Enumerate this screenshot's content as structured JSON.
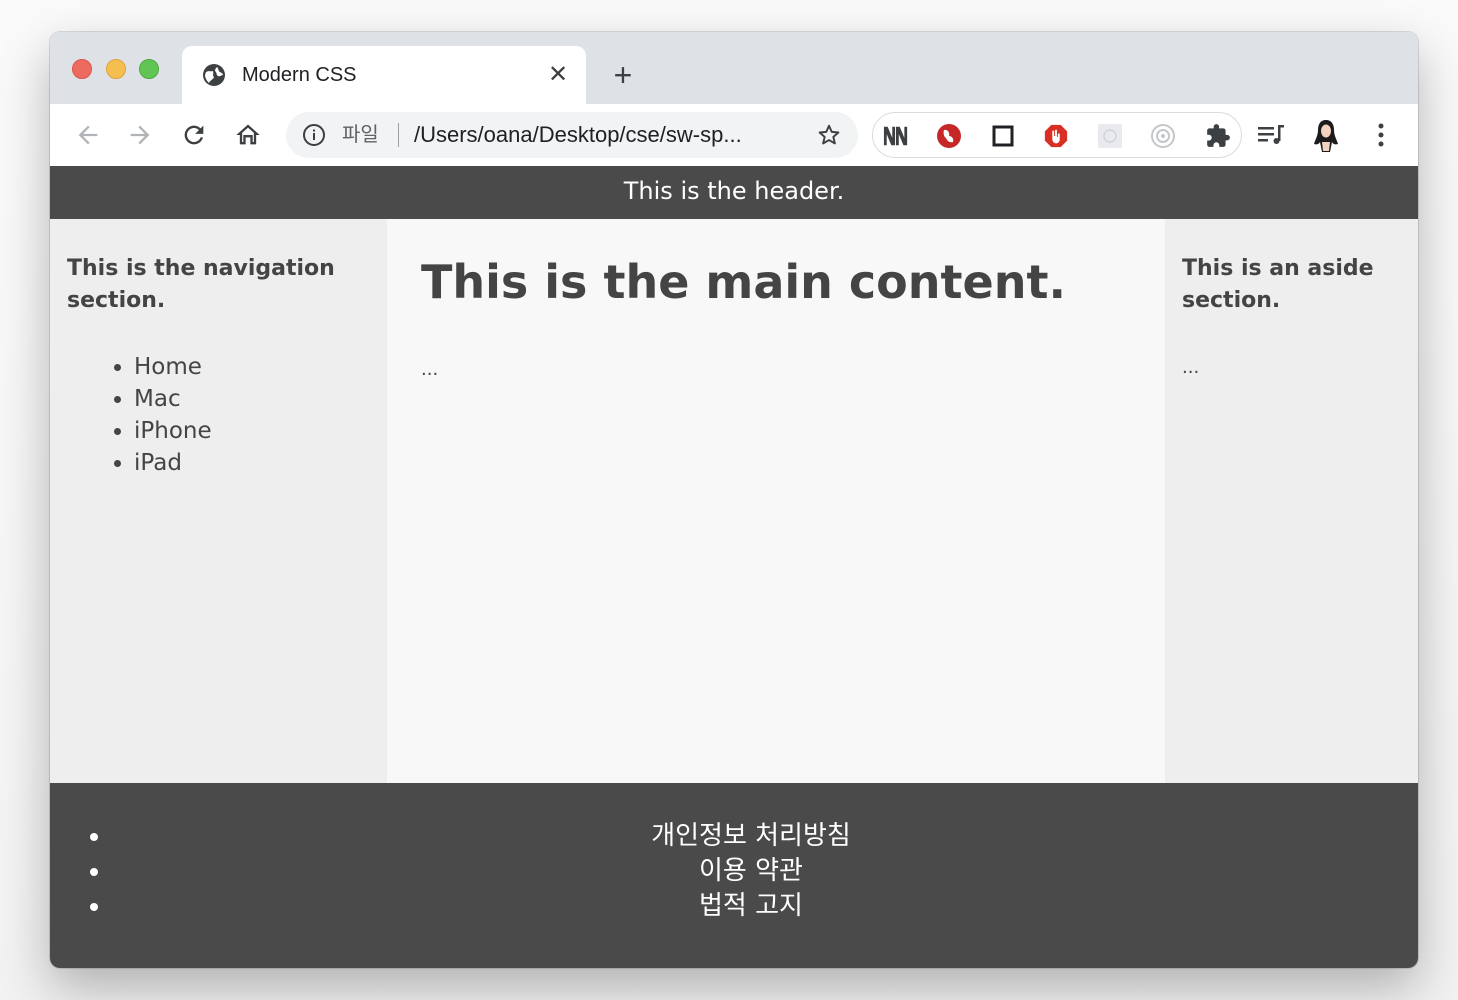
{
  "browser": {
    "tab": {
      "title": "Modern CSS",
      "favicon": "globe-icon"
    },
    "address_bar": {
      "scheme_label": "파일",
      "url": "/Users/oana/Desktop/cse/sw-sp..."
    },
    "extensions": [
      "nn-extension-icon",
      "red-circle-extension-icon",
      "square-extension-icon",
      "adblock-extension-icon",
      "grey-box-extension-icon",
      "target-extension-icon",
      "puzzle-icon"
    ]
  },
  "page": {
    "header_text": "This is the header.",
    "nav": {
      "title": "This is the navigation section.",
      "items": [
        "Home",
        "Mac",
        "iPhone",
        "iPad"
      ]
    },
    "main": {
      "title": "This is the main content.",
      "body": "..."
    },
    "aside": {
      "title": "This is an aside section.",
      "body": "..."
    },
    "footer": {
      "links": [
        "개인정보 처리방침",
        "이용 약관",
        "법적 고지"
      ]
    }
  },
  "colors": {
    "header_bg": "#4a4a4a",
    "side_bg": "#eeeeee",
    "main_bg": "#f8f8f8",
    "text": "#444444"
  }
}
